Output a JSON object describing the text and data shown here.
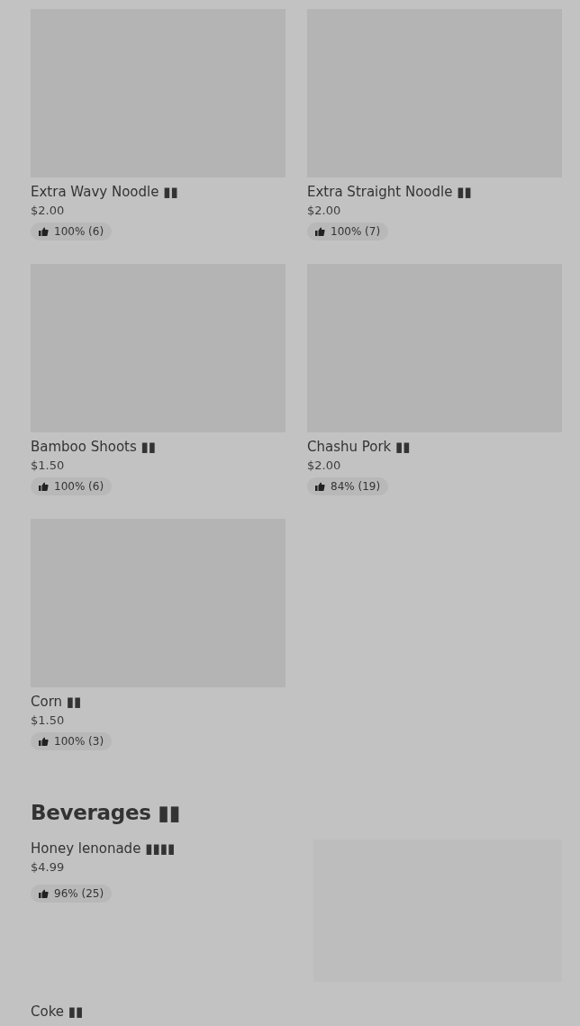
{
  "items": [
    {
      "name": "Extra Wavy Noodle ▮▮",
      "price": "$2.00",
      "rating": "100% (6)"
    },
    {
      "name": "Extra Straight Noodle ▮▮",
      "price": "$2.00",
      "rating": "100% (7)"
    },
    {
      "name": "Bamboo Shoots ▮▮",
      "price": "$1.50",
      "rating": "100% (6)"
    },
    {
      "name": "Chashu Pork ▮▮",
      "price": "$2.00",
      "rating": "84% (19)"
    },
    {
      "name": "Corn ▮▮",
      "price": "$1.50",
      "rating": "100% (3)"
    }
  ],
  "beverages": {
    "heading": "Beverages ▮▮",
    "items": [
      {
        "name": "Honey lenonade ▮▮▮▮",
        "price": "$4.99",
        "rating": "96% (25)"
      },
      {
        "name": "Coke ▮▮"
      }
    ]
  }
}
